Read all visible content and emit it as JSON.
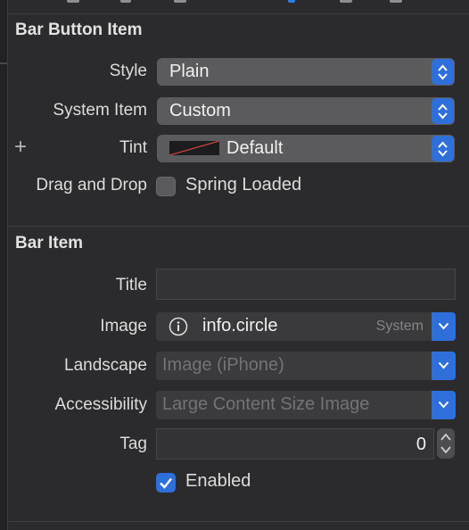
{
  "bar_button_item": {
    "title": "Bar Button Item",
    "style_label": "Style",
    "style_value": "Plain",
    "system_item_label": "System Item",
    "system_item_value": "Custom",
    "add_variation_glyph": "+",
    "tint_label": "Tint",
    "tint_value": "Default",
    "drag_drop_label": "Drag and Drop",
    "spring_loaded_label": "Spring Loaded",
    "spring_loaded_checked": false
  },
  "bar_item": {
    "title": "Bar Item",
    "title_label": "Title",
    "title_value": "",
    "image_label": "Image",
    "image_value": "info.circle",
    "image_source": "System",
    "image_icon": "info-circle-icon",
    "landscape_label": "Landscape",
    "landscape_placeholder": "Image (iPhone)",
    "accessibility_label": "Accessibility",
    "accessibility_placeholder": "Large Content Size Image",
    "tag_label": "Tag",
    "tag_value": "0",
    "enabled_label": "Enabled",
    "enabled_checked": true
  },
  "colors": {
    "panel_background": "#2b2b2d",
    "accent_blue": "#2f6fd9",
    "popup_fill": "#5b5b5d",
    "tint_swatch_line": "#d0453a"
  }
}
